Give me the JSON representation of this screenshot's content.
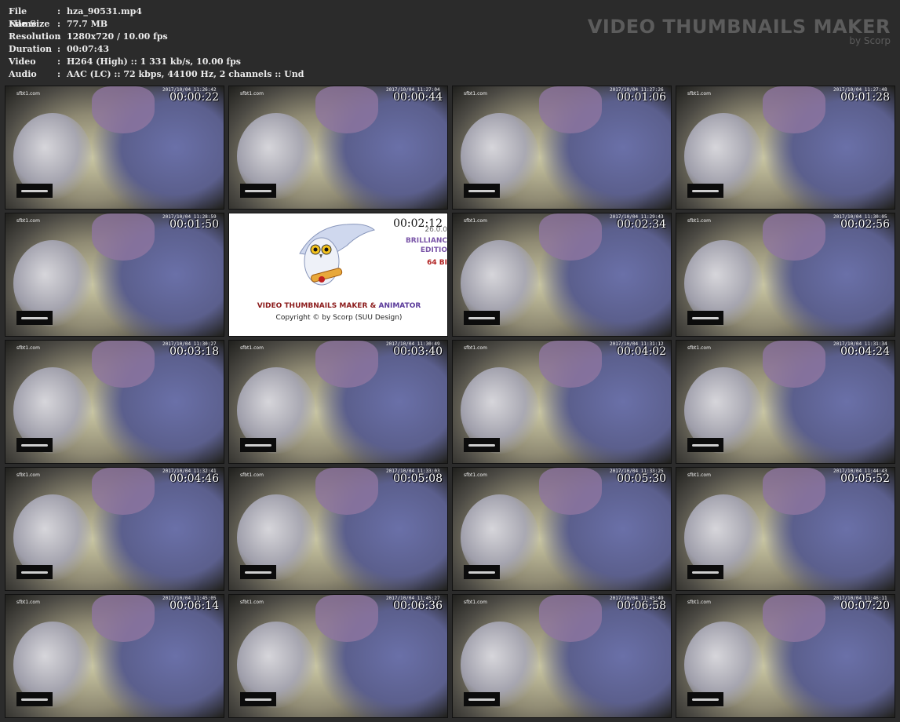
{
  "info": [
    {
      "label": "File Name",
      "value": "hza_90531.mp4"
    },
    {
      "label": "File Size",
      "value": "77.7 MB"
    },
    {
      "label": "Resolution",
      "value": "1280x720 / 10.00 fps"
    },
    {
      "label": "Duration",
      "value": "00:07:43"
    },
    {
      "label": "Video",
      "value": "H264 (High) :: 1 331 kb/s, 10.00 fps"
    },
    {
      "label": "Audio",
      "value": "AAC (LC) :: 72 kbps, 44100 Hz, 2 channels :: Und"
    }
  ],
  "separator": ":",
  "brand": {
    "title": "VIDEO THUMBNAILS MAKER",
    "subtitle": "by Scorp"
  },
  "site_label": "sfbt1.com",
  "thumbnails": [
    {
      "time": "00:00:22",
      "cam": "2017/10/04 11:26:42"
    },
    {
      "time": "00:00:44",
      "cam": "2017/10/04 11:27:04"
    },
    {
      "time": "00:01:06",
      "cam": "2017/10/04 11:27:26"
    },
    {
      "time": "00:01:28",
      "cam": "2017/10/04 11:27:48"
    },
    {
      "time": "00:01:50",
      "cam": "2017/10/04 11:28:59"
    },
    {
      "time": "00:02:12",
      "cam": ""
    },
    {
      "time": "00:02:34",
      "cam": "2017/10/04 11:29:43"
    },
    {
      "time": "00:02:56",
      "cam": "2017/10/04 11:30:05"
    },
    {
      "time": "00:03:18",
      "cam": "2017/10/04 11:30:27"
    },
    {
      "time": "00:03:40",
      "cam": "2017/10/04 11:30:49"
    },
    {
      "time": "00:04:02",
      "cam": "2017/10/04 11:31:12"
    },
    {
      "time": "00:04:24",
      "cam": "2017/10/04 11:31:34"
    },
    {
      "time": "00:04:46",
      "cam": "2017/10/04 11:32:41"
    },
    {
      "time": "00:05:08",
      "cam": "2017/10/04 11:33:03"
    },
    {
      "time": "00:05:30",
      "cam": "2017/10/04 11:33:25"
    },
    {
      "time": "00:05:52",
      "cam": "2017/10/04 11:44:43"
    },
    {
      "time": "00:06:14",
      "cam": "2017/10/04 11:45:05"
    },
    {
      "time": "00:06:36",
      "cam": "2017/10/04 11:45:27"
    },
    {
      "time": "00:06:58",
      "cam": "2017/10/04 11:45:49"
    },
    {
      "time": "00:07:20",
      "cam": "2017/10/04 11:46:11"
    }
  ],
  "promo": {
    "version": "26.0.0",
    "edition_line1": "BRILLIANC",
    "edition_line2": "EDITIO",
    "bits": "64 BI",
    "title_part1": "VIDEO THUMBNAILS MAKER",
    "title_amp": " & ",
    "title_part2": "ANIMATOR",
    "copyright": "Copyright © by Scorp (SUU Design)",
    "title_color1": "#8b1a1a",
    "title_color2": "#5a3a9a"
  }
}
